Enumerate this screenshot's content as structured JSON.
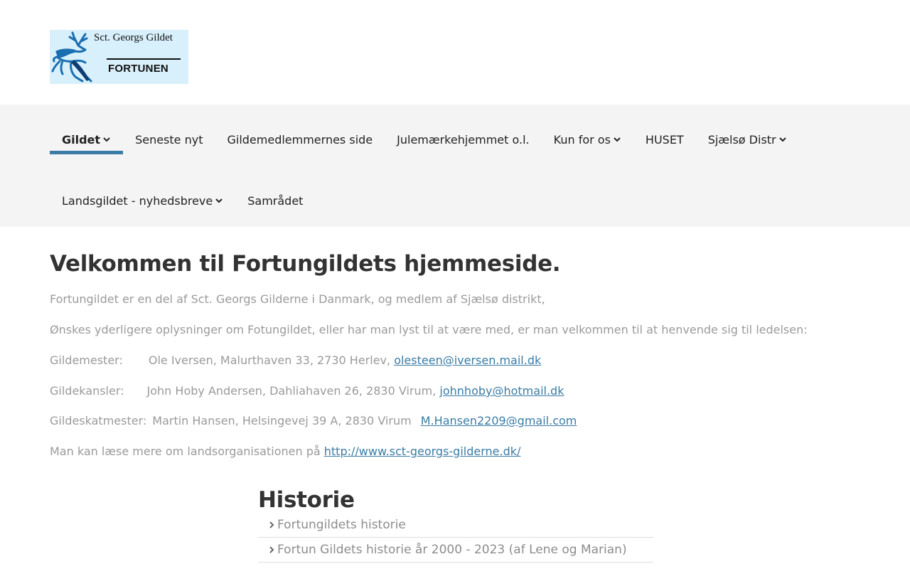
{
  "logo": {
    "line1": "Sct. Georgs Gildet",
    "line2": "FORTUNEN",
    "bg_color": "#d8f0fb",
    "deer_color": "#1a6fb0"
  },
  "menu": {
    "accent": "#3a7ca5",
    "row1": [
      {
        "label": "Gildet",
        "dropdown": true,
        "active": true
      },
      {
        "label": "Seneste nyt",
        "dropdown": false
      },
      {
        "label": "Gildemedlemmernes side",
        "dropdown": false
      },
      {
        "label": "Julemærkehjemmet o.l.",
        "dropdown": false
      },
      {
        "label": "Kun for os",
        "dropdown": true
      },
      {
        "label": "HUSET",
        "dropdown": false
      },
      {
        "label": "Sjælsø Distr",
        "dropdown": true
      }
    ],
    "row2": [
      {
        "label": "Landsgildet - nyhedsbreve",
        "dropdown": true
      },
      {
        "label": "Samrådet",
        "dropdown": false
      }
    ]
  },
  "content": {
    "title": "Velkommen til Fortungildets hjemmeside.",
    "intro": "Fortungildet er en del af Sct. Georgs Gilderne i Danmark, og medlem af Sjælsø distrikt,",
    "contact_intro": "Ønskes yderligere oplysninger om Fotungildet, eller har man lyst til at være med, er man velkommen til at henvende sig til ledelsen:",
    "contacts": [
      {
        "role": "Gildemester:",
        "details": "Ole Iversen, Malurthaven 33, 2730 Herlev,",
        "email": "olesteen@iversen.mail.dk"
      },
      {
        "role": "Gildekansler:",
        "details": "John Hoby Andersen, Dahliahaven 26, 2830 Virum,",
        "email": "johnhoby@hotmail.dk"
      },
      {
        "role": "Gildeskatmester:",
        "details": "Martin Hansen, Helsingevej 39 A, 2830 Virum",
        "email": "M.Hansen2209@gmail.com"
      }
    ],
    "more_text": "Man kan læse mere om landsorganisationen på",
    "more_link": "http://www.sct-georgs-gilderne.dk/"
  },
  "history": {
    "title": "Historie",
    "items": [
      "Fortungildets historie",
      "Fortun Gildets historie år 2000 - 2023 (af Lene og Marian)"
    ]
  }
}
